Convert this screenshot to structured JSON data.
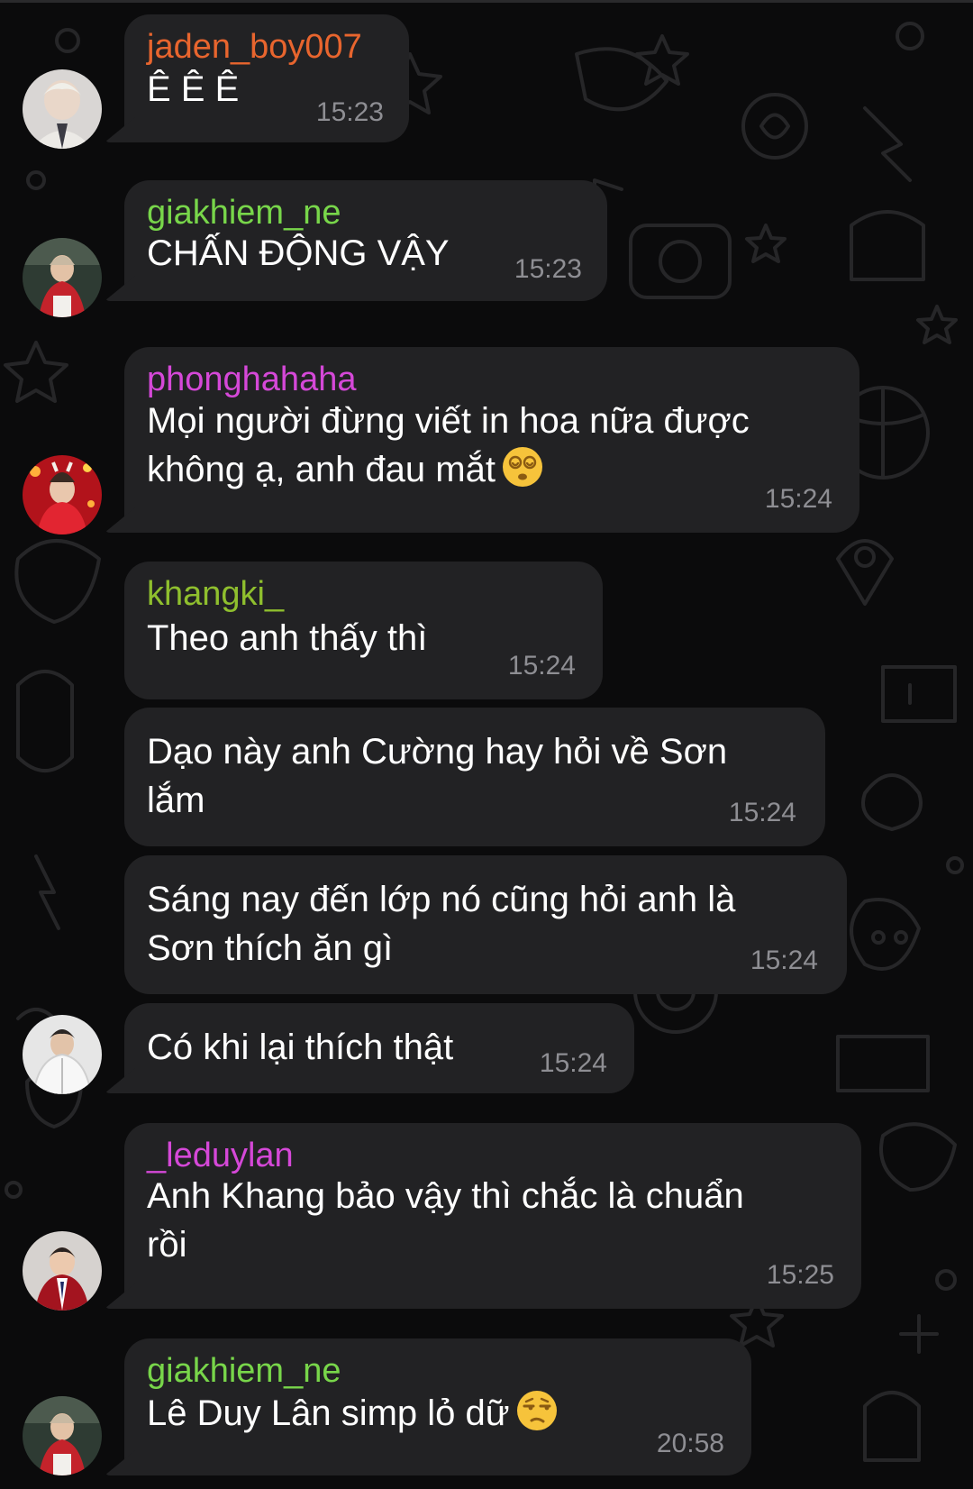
{
  "colors": {
    "background": "#0b0b0c",
    "bubble": "#222224",
    "message_text": "#ffffff",
    "timestamp": "#8e8e93",
    "name_orange": "#e8652e",
    "name_green": "#78d64a",
    "name_magenta": "#d548d8",
    "name_olive": "#8fbf2e"
  },
  "messages": [
    {
      "sender": "jaden_boy007",
      "sender_color": "#e8652e",
      "lines": [
        "Ê Ê Ê"
      ],
      "time": "15:23",
      "avatar": "avatar-jaden"
    },
    {
      "sender": "giakhiem_ne",
      "sender_color": "#78d64a",
      "lines": [
        "CHẤN ĐỘNG VẬY"
      ],
      "time": "15:23",
      "avatar": "avatar-giakhiem"
    },
    {
      "sender": "phonghahaha",
      "sender_color": "#d548d8",
      "lines": [
        "Mọi người đừng viết in hoa nữa được",
        "không ạ, anh đau mắt"
      ],
      "emoji": "dizzy-face-emoji",
      "time": "15:24",
      "avatar": "avatar-phong"
    },
    {
      "sender": "khangki_",
      "sender_color": "#8fbf2e",
      "lines": [
        "Theo anh thấy thì"
      ],
      "time": "15:24"
    },
    {
      "lines": [
        "Dạo này anh Cường hay hỏi về Sơn",
        "lắm"
      ],
      "time": "15:24"
    },
    {
      "lines": [
        "Sáng nay đến lớp nó cũng hỏi anh là",
        "Sơn thích ăn gì"
      ],
      "time": "15:24"
    },
    {
      "lines": [
        "Có khi lại thích thật"
      ],
      "time": "15:24",
      "avatar": "avatar-khangki"
    },
    {
      "sender": "_leduylan",
      "sender_color": "#d548d8",
      "lines": [
        "Anh Khang bảo vậy thì chắc là chuẩn",
        "rồi"
      ],
      "time": "15:25",
      "avatar": "avatar-leduylan"
    },
    {
      "sender": "giakhiem_ne",
      "sender_color": "#78d64a",
      "lines": [
        "Lê Duy Lân simp lỏ dữ"
      ],
      "emoji": "unamused-face-emoji",
      "time": "20:58",
      "avatar": "avatar-giakhiem"
    }
  ]
}
